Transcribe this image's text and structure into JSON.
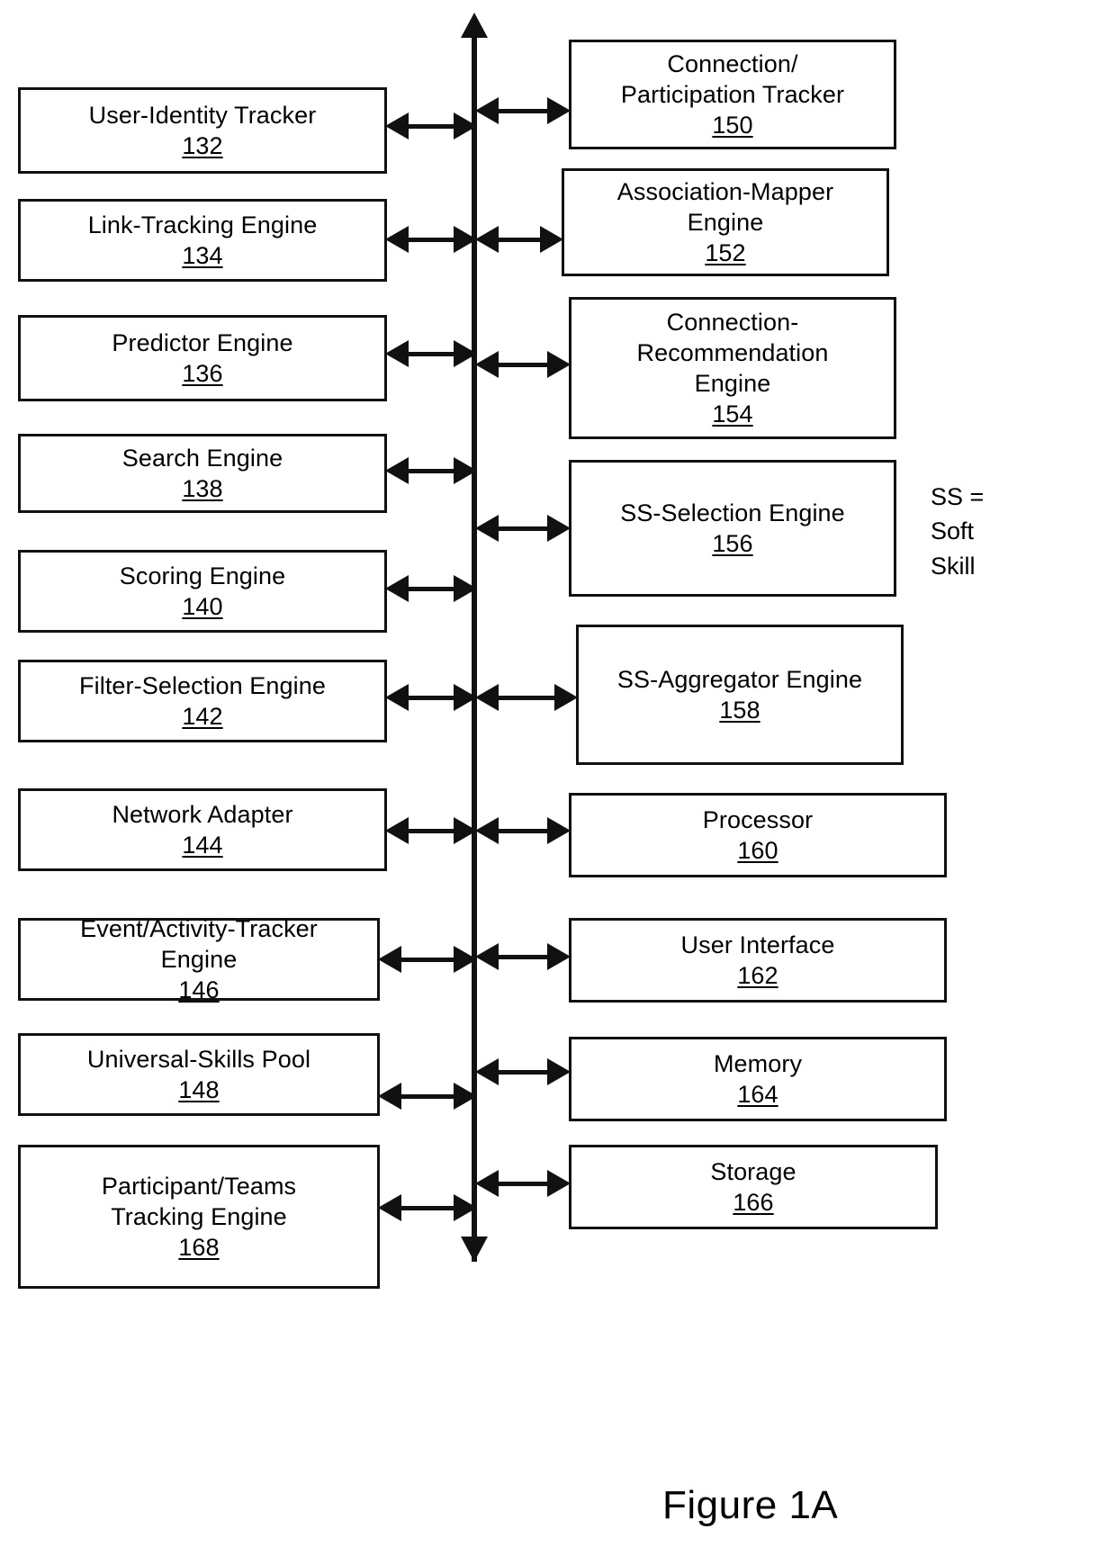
{
  "figure": {
    "caption": "Figure 1A"
  },
  "legend": {
    "text": "SS =\nSoft\nSkill"
  },
  "bus": {
    "name": "system-bus",
    "top_arrow": "arrow-up",
    "bottom_arrow": "arrow-down"
  },
  "left_column": [
    {
      "title": "User-Identity Tracker",
      "number": "132",
      "inline": false
    },
    {
      "title": "Link-Tracking Engine",
      "number": "134",
      "inline": false
    },
    {
      "title": "Predictor Engine",
      "number": "136",
      "inline": false
    },
    {
      "title": "Search Engine",
      "number": "138",
      "inline": false
    },
    {
      "title": "Scoring Engine",
      "number": "140",
      "inline": false
    },
    {
      "title": "Filter-Selection Engine",
      "number": "142",
      "inline": false
    },
    {
      "title": "Network Adapter",
      "number": "144",
      "inline": false
    },
    {
      "title": "Event/Activity-Tracker\nEngine ",
      "number": "146",
      "inline": true
    },
    {
      "title": "Universal-Skills Pool",
      "number": "148",
      "inline": false
    },
    {
      "title": "Participant/Teams\nTracking Engine",
      "number": "168",
      "inline": false
    }
  ],
  "right_column": [
    {
      "title": "Connection/\nParticipation Tracker",
      "number": "150"
    },
    {
      "title": "Association-Mapper\nEngine",
      "number": "152"
    },
    {
      "title": "Connection-\nRecommendation\nEngine",
      "number": "154"
    },
    {
      "title": "SS-Selection Engine",
      "number": "156"
    },
    {
      "title": "SS-Aggregator Engine",
      "number": "158"
    },
    {
      "title": "Processor",
      "number": "160"
    },
    {
      "title": "User Interface",
      "number": "162"
    },
    {
      "title": "Memory",
      "number": "164"
    },
    {
      "title": "Storage",
      "number": "166"
    }
  ]
}
